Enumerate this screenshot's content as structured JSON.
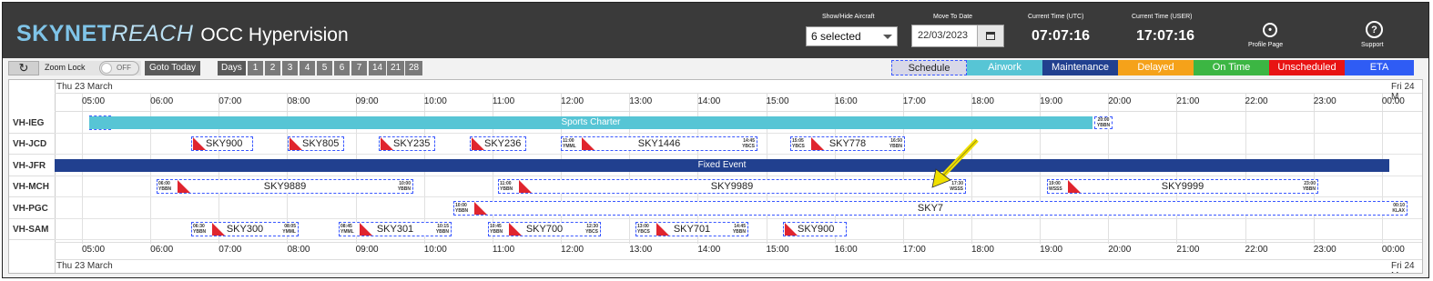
{
  "colors": {
    "header_bg": "#3a3a3a",
    "airwork": "#57c5d5",
    "maintenance": "#21408f",
    "delayed": "#f5a21a",
    "on_time": "#3cb643",
    "unscheduled": "#e81313",
    "eta": "#2f5cf4",
    "flight_border": "#3a58ff",
    "flight_marker": "#e0252e"
  },
  "header": {
    "brand_bold": "SKYNET",
    "brand_italic": "REACH",
    "app_title": "OCC Hypervision",
    "show_hide_label": "Show/Hide Aircraft",
    "show_hide_value": "6 selected",
    "move_to_date_label": "Move To Date",
    "move_to_date_value": "22/03/2023",
    "utc_label": "Current Time (UTC)",
    "utc_value": "07:07:16",
    "user_label": "Current Time (USER)",
    "user_value": "17:07:16",
    "profile_label": "Profile Page",
    "support_label": "Support",
    "icons": [
      "user-circle-icon",
      "question-circle-icon",
      "calendar-icon",
      "chevron-down-icon",
      "refresh-icon"
    ]
  },
  "toolbar": {
    "zoom_lock_label": "Zoom Lock",
    "zoom_lock_state": "OFF",
    "goto_today": "Goto Today",
    "days_label": "Days",
    "days": [
      "1",
      "2",
      "3",
      "4",
      "5",
      "6",
      "7",
      "14",
      "21",
      "28"
    ],
    "legend": [
      "Schedule",
      "Airwork",
      "Maintenance",
      "Delayed",
      "On Time",
      "Unscheduled",
      "ETA"
    ]
  },
  "timeline": {
    "start_date": "Thu 23 March",
    "end_date": "Fri 24 M",
    "hours": [
      "05:00",
      "06:00",
      "07:00",
      "08:00",
      "09:00",
      "10:00",
      "11:00",
      "12:00",
      "13:00",
      "14:00",
      "15:00",
      "16:00",
      "17:00",
      "18:00",
      "19:00",
      "20:00",
      "21:00",
      "22:00",
      "23:00",
      "00:00"
    ]
  },
  "rows": [
    {
      "reg": "VH-IEG",
      "items": [
        {
          "name": "",
          "start": "05:00",
          "start_port": "YBBN",
          "end": "",
          "end_port": ""
        },
        {
          "type": "airwork",
          "name": "Sports Charter",
          "start": "",
          "start_port": "",
          "end": "20:00",
          "end_port": "YBBN"
        }
      ]
    },
    {
      "reg": "VH-JCD",
      "items": [
        {
          "name": "SKY900",
          "start": "",
          "start_port": "",
          "end": "",
          "end_port": ""
        },
        {
          "name": "SKY805",
          "start": "",
          "start_port": "",
          "end": "",
          "end_port": ""
        },
        {
          "name": "SKY235",
          "start": "",
          "start_port": "",
          "end": "",
          "end_port": ""
        },
        {
          "name": "SKY236",
          "start": "",
          "start_port": "",
          "end": "",
          "end_port": ""
        },
        {
          "name": "SKY1446",
          "start": "11:00",
          "start_port": "YMML",
          "end": "14:45",
          "end_port": "YBCS"
        },
        {
          "name": "SKY778",
          "start": "15:05",
          "start_port": "YBCS",
          "end": "16:50",
          "end_port": "YBBN"
        }
      ]
    },
    {
      "reg": "VH-JFR",
      "items": [
        {
          "type": "maintenance",
          "name": "Fixed Event"
        }
      ]
    },
    {
      "reg": "VH-MCH",
      "items": [
        {
          "name": "SKY9889",
          "start": "06:00",
          "start_port": "YBBN",
          "end": "10:00",
          "end_port": "YBBN"
        },
        {
          "name": "SKY9989",
          "start": "11:00",
          "start_port": "YBBN",
          "end": "17:30",
          "end_port": "WSSS"
        },
        {
          "name": "SKY9999",
          "start": "19:00",
          "start_port": "WSSS",
          "end": "23:00",
          "end_port": "YBBN"
        }
      ]
    },
    {
      "reg": "VH-PGC",
      "items": [
        {
          "name": "SKY7",
          "start": "10:00",
          "start_port": "YBBN",
          "end": "00:10",
          "end_port": "KLAX"
        }
      ]
    },
    {
      "reg": "VH-SAM",
      "items": [
        {
          "name": "SKY300",
          "start": "06:30",
          "start_port": "YBBN",
          "end": "08:05",
          "end_port": "YMML"
        },
        {
          "name": "SKY301",
          "start": "08:45",
          "start_port": "YMML",
          "end": "10:15",
          "end_port": "YBBN"
        },
        {
          "name": "SKY700",
          "start": "10:45",
          "start_port": "YBBN",
          "end": "12:30",
          "end_port": "YBCS"
        },
        {
          "name": "SKY701",
          "start": "13:00",
          "start_port": "YBCS",
          "end": "14:45",
          "end_port": "YBBN"
        },
        {
          "name": "SKY900",
          "start": "",
          "start_port": "",
          "end": "",
          "end_port": ""
        }
      ]
    }
  ]
}
